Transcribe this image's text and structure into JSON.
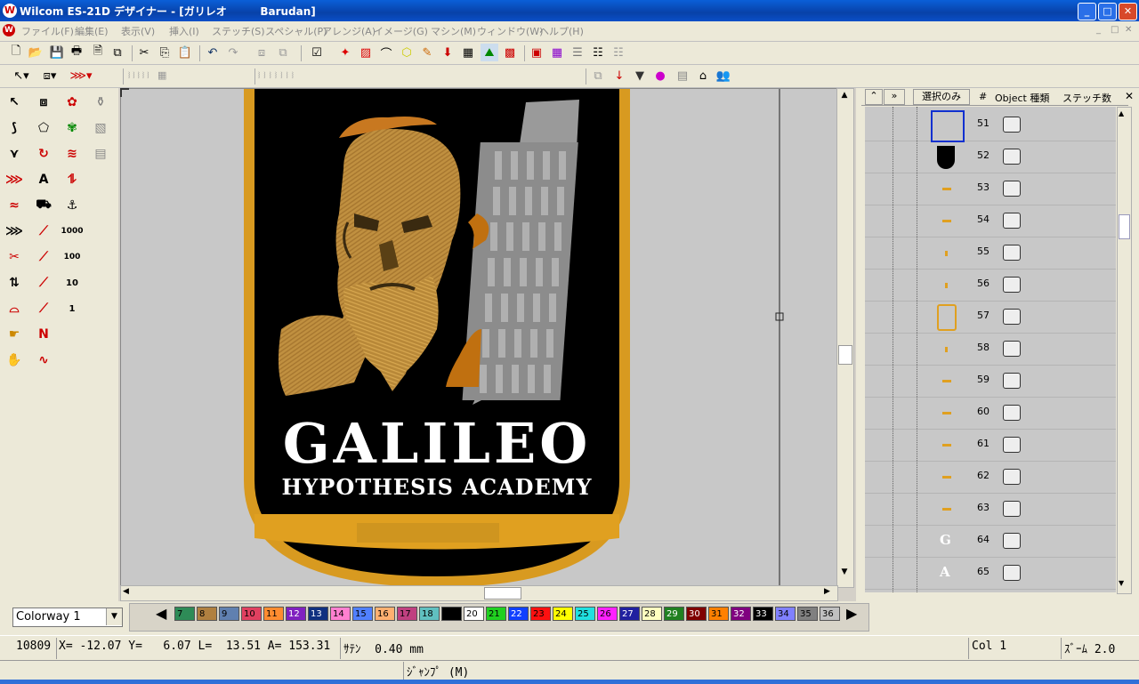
{
  "window": {
    "app_icon": "W",
    "title": "Wilcom ES-21D デザイナー - [ガリレオ         Barudan]",
    "min": "_",
    "max": "□",
    "close": "✕"
  },
  "menu": [
    {
      "label": "ファイル(F)"
    },
    {
      "label": "編集(E)"
    },
    {
      "label": "表示(V)"
    },
    {
      "label": "挿入(I)"
    },
    {
      "label": "ステッチ(S)"
    },
    {
      "label": "スペシャル(P)"
    },
    {
      "label": "アレンジ(A)"
    },
    {
      "label": "イメージ(G)"
    },
    {
      "label": "マシン(M)"
    },
    {
      "label": "ウィンドウ(W)"
    },
    {
      "label": "ヘルプ(H)"
    }
  ],
  "design": {
    "title": "GALILEO",
    "subtitle": "HYPOTHESIS ACADEMY"
  },
  "objects_panel": {
    "headers": {
      "up": "⌃",
      "down": "»",
      "select_only": "選択のみ",
      "num": "#",
      "object_type": "Object 種類",
      "stitch_count": "ステッチ数"
    },
    "close": "✕",
    "rows": [
      {
        "num": "51",
        "thumb": "selected-box"
      },
      {
        "num": "52",
        "thumb": "black-shape"
      },
      {
        "num": "53",
        "thumb": "gold-dash"
      },
      {
        "num": "54",
        "thumb": "gold-dash"
      },
      {
        "num": "55",
        "thumb": "gold-dot"
      },
      {
        "num": "56",
        "thumb": "gold-dot"
      },
      {
        "num": "57",
        "thumb": "gold-bracket"
      },
      {
        "num": "58",
        "thumb": "gold-dot"
      },
      {
        "num": "59",
        "thumb": "gold-dash"
      },
      {
        "num": "60",
        "thumb": "gold-dash"
      },
      {
        "num": "61",
        "thumb": "gold-dash"
      },
      {
        "num": "62",
        "thumb": "gold-dash"
      },
      {
        "num": "63",
        "thumb": "gold-dash"
      },
      {
        "num": "64",
        "thumb": "G"
      },
      {
        "num": "65",
        "thumb": "A"
      }
    ]
  },
  "palette": {
    "colorway": "Colorway 1",
    "swatches": [
      {
        "n": "7",
        "c": "#2e8b57"
      },
      {
        "n": "8",
        "c": "#b08040"
      },
      {
        "n": "9",
        "c": "#6080b0"
      },
      {
        "n": "10",
        "c": "#e04060"
      },
      {
        "n": "11",
        "c": "#ff8c30"
      },
      {
        "n": "12",
        "c": "#8020c0"
      },
      {
        "n": "13",
        "c": "#103080"
      },
      {
        "n": "14",
        "c": "#ff80d0"
      },
      {
        "n": "15",
        "c": "#5080ff"
      },
      {
        "n": "16",
        "c": "#ffb070"
      },
      {
        "n": "17",
        "c": "#c04080"
      },
      {
        "n": "18",
        "c": "#60c0c0"
      },
      {
        "n": "",
        "c": "#000000"
      },
      {
        "n": "20",
        "c": "#ffffff"
      },
      {
        "n": "21",
        "c": "#20d020"
      },
      {
        "n": "22",
        "c": "#1040ff"
      },
      {
        "n": "23",
        "c": "#ff1010"
      },
      {
        "n": "24",
        "c": "#ffff00"
      },
      {
        "n": "25",
        "c": "#20e0e0"
      },
      {
        "n": "26",
        "c": "#ff20ff"
      },
      {
        "n": "27",
        "c": "#2020a0"
      },
      {
        "n": "28",
        "c": "#ffffc0"
      },
      {
        "n": "29",
        "c": "#208020"
      },
      {
        "n": "30",
        "c": "#800000"
      },
      {
        "n": "31",
        "c": "#ff8000"
      },
      {
        "n": "32",
        "c": "#800080"
      },
      {
        "n": "33",
        "c": "#000000"
      },
      {
        "n": "34",
        "c": "#8080ff"
      },
      {
        "n": "35",
        "c": "#808080"
      },
      {
        "n": "36",
        "c": "#c0c0c0"
      }
    ]
  },
  "status": {
    "stitch": "10809",
    "coords": "X= -12.07 Y=   6.07 L=  13.51 A= 153.31",
    "width": "ｻﾃﾝ  0.40 mm",
    "col": "Col 1",
    "zoom": "ｽﾞｰﾑ 2.0",
    "mode": "ｼﾞｬﾝﾌﾟ (M)"
  }
}
